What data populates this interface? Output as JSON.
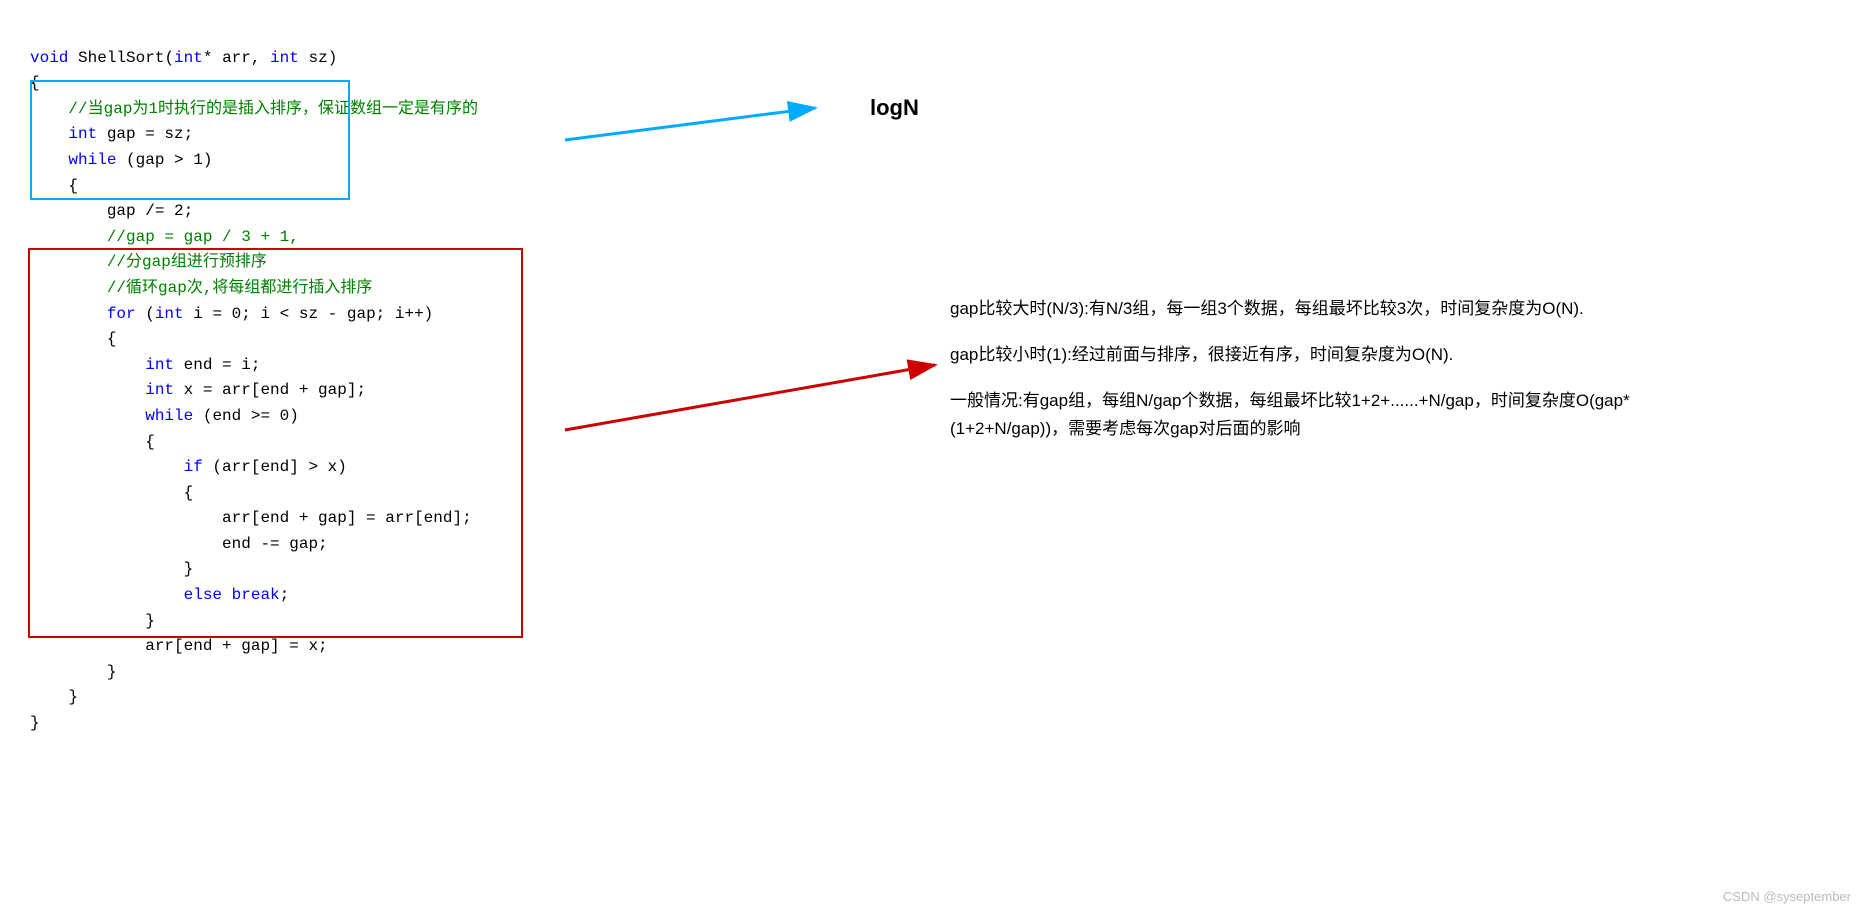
{
  "code": {
    "line1": "void ShellSort(int* arr, int sz)",
    "line2": "{",
    "line3": "    //当gap为1时执行的是插入排序，保证数组一定是有序的",
    "line4": "    int gap = sz;",
    "line5": "    while (gap > 1)",
    "line6": "    {",
    "line7": "        gap /= 2;",
    "line8": "        //gap = gap / 3 + 1,",
    "line9": "        //分gap组进行预排序",
    "line10": "        //循环gap次,将每组都进行插入排序",
    "line11": "        for (int i = 0; i < sz - gap; i++)",
    "line12": "        {",
    "line13": "            int end = i;",
    "line14": "            int x = arr[end + gap];",
    "line15": "            while (end >= 0)",
    "line16": "            {",
    "line17": "                if (arr[end] > x)",
    "line18": "                {",
    "line19": "                    arr[end + gap] = arr[end];",
    "line20": "                    end -= gap;",
    "line21": "                }",
    "line22": "                else break;",
    "line23": "            }",
    "line24": "            arr[end + gap] = x;",
    "line25": "        }",
    "line26": "    }",
    "line27": "}"
  },
  "labels": {
    "logn": "logN"
  },
  "descriptions": {
    "para1": "gap比较大时(N/3):有N/3组，每一组3个数据，每组最坏比较3次，时间复杂度为O(N).",
    "para2": "gap比较小时(1):经过前面与排序，很接近有序，时间复杂度为O(N).",
    "para3": "一般情况:有gap组，每组N/gap个数据，每组最坏比较1+2+......+N/gap，时间复杂度O(gap*(1+2+N/gap))，需要考虑每次gap对后面的影响"
  },
  "watermark": "CSDN @syseptember"
}
